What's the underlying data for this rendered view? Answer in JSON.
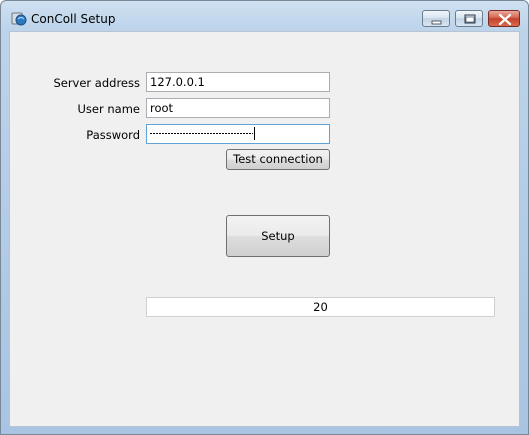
{
  "window": {
    "title": "ConColl Setup"
  },
  "form": {
    "server_label": "Server address",
    "server_value": "127.0.0.1",
    "username_label": "User name",
    "username_value": "root",
    "password_label": "Password",
    "test_button_label": "Test connection",
    "setup_button_label": "Setup"
  },
  "status": {
    "value": "20"
  },
  "colors": {
    "title_bar": "#bcd3ea",
    "client_bg": "#f0f0f0",
    "close_button": "#c2412a",
    "focus_border": "#5ea2d8"
  }
}
